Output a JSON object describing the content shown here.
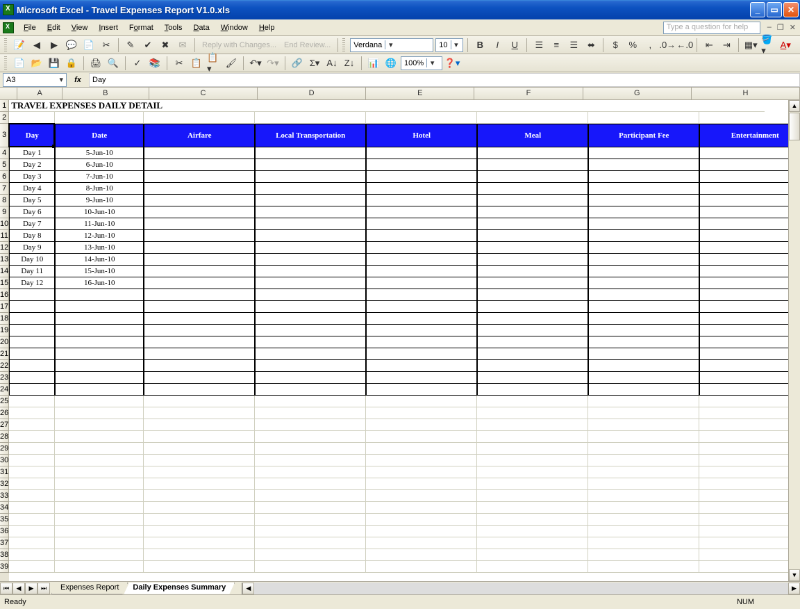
{
  "window": {
    "title": "Microsoft Excel - Travel Expenses Report V1.0.xls"
  },
  "menu": {
    "file": "File",
    "edit": "Edit",
    "view": "View",
    "insert": "Insert",
    "format": "Format",
    "tools": "Tools",
    "data": "Data",
    "window": "Window",
    "help": "Help",
    "helpbox_placeholder": "Type a question for help"
  },
  "toolbar1": {
    "reply": "Reply with Changes...",
    "end": "End Review...",
    "font": "Verdana",
    "size": "10"
  },
  "toolbar2": {
    "zoom": "100%"
  },
  "formula": {
    "namebox": "A3",
    "value": "Day"
  },
  "columns": [
    "A",
    "B",
    "C",
    "D",
    "E",
    "F",
    "G",
    "H"
  ],
  "sheet": {
    "title": "TRAVEL EXPENSES DAILY DETAIL",
    "headers": [
      "Day",
      "Date",
      "Airfare",
      "Local Transportation",
      "Hotel",
      "Meal",
      "Participant Fee",
      "Entertainment"
    ],
    "rows": [
      {
        "day": "Day 1",
        "date": "5-Jun-10"
      },
      {
        "day": "Day 2",
        "date": "6-Jun-10"
      },
      {
        "day": "Day 3",
        "date": "7-Jun-10"
      },
      {
        "day": "Day 4",
        "date": "8-Jun-10"
      },
      {
        "day": "Day 5",
        "date": "9-Jun-10"
      },
      {
        "day": "Day 6",
        "date": "10-Jun-10"
      },
      {
        "day": "Day 7",
        "date": "11-Jun-10"
      },
      {
        "day": "Day 8",
        "date": "12-Jun-10"
      },
      {
        "day": "Day 9",
        "date": "13-Jun-10"
      },
      {
        "day": "Day 10",
        "date": "14-Jun-10"
      },
      {
        "day": "Day 11",
        "date": "15-Jun-10"
      },
      {
        "day": "Day 12",
        "date": "16-Jun-10"
      }
    ],
    "empty_bordered_rows": 9,
    "plain_rows_after": 15
  },
  "tabs": {
    "t1": "Expenses Report",
    "t2": "Daily Expenses Summary"
  },
  "status": {
    "ready": "Ready",
    "num": "NUM"
  }
}
